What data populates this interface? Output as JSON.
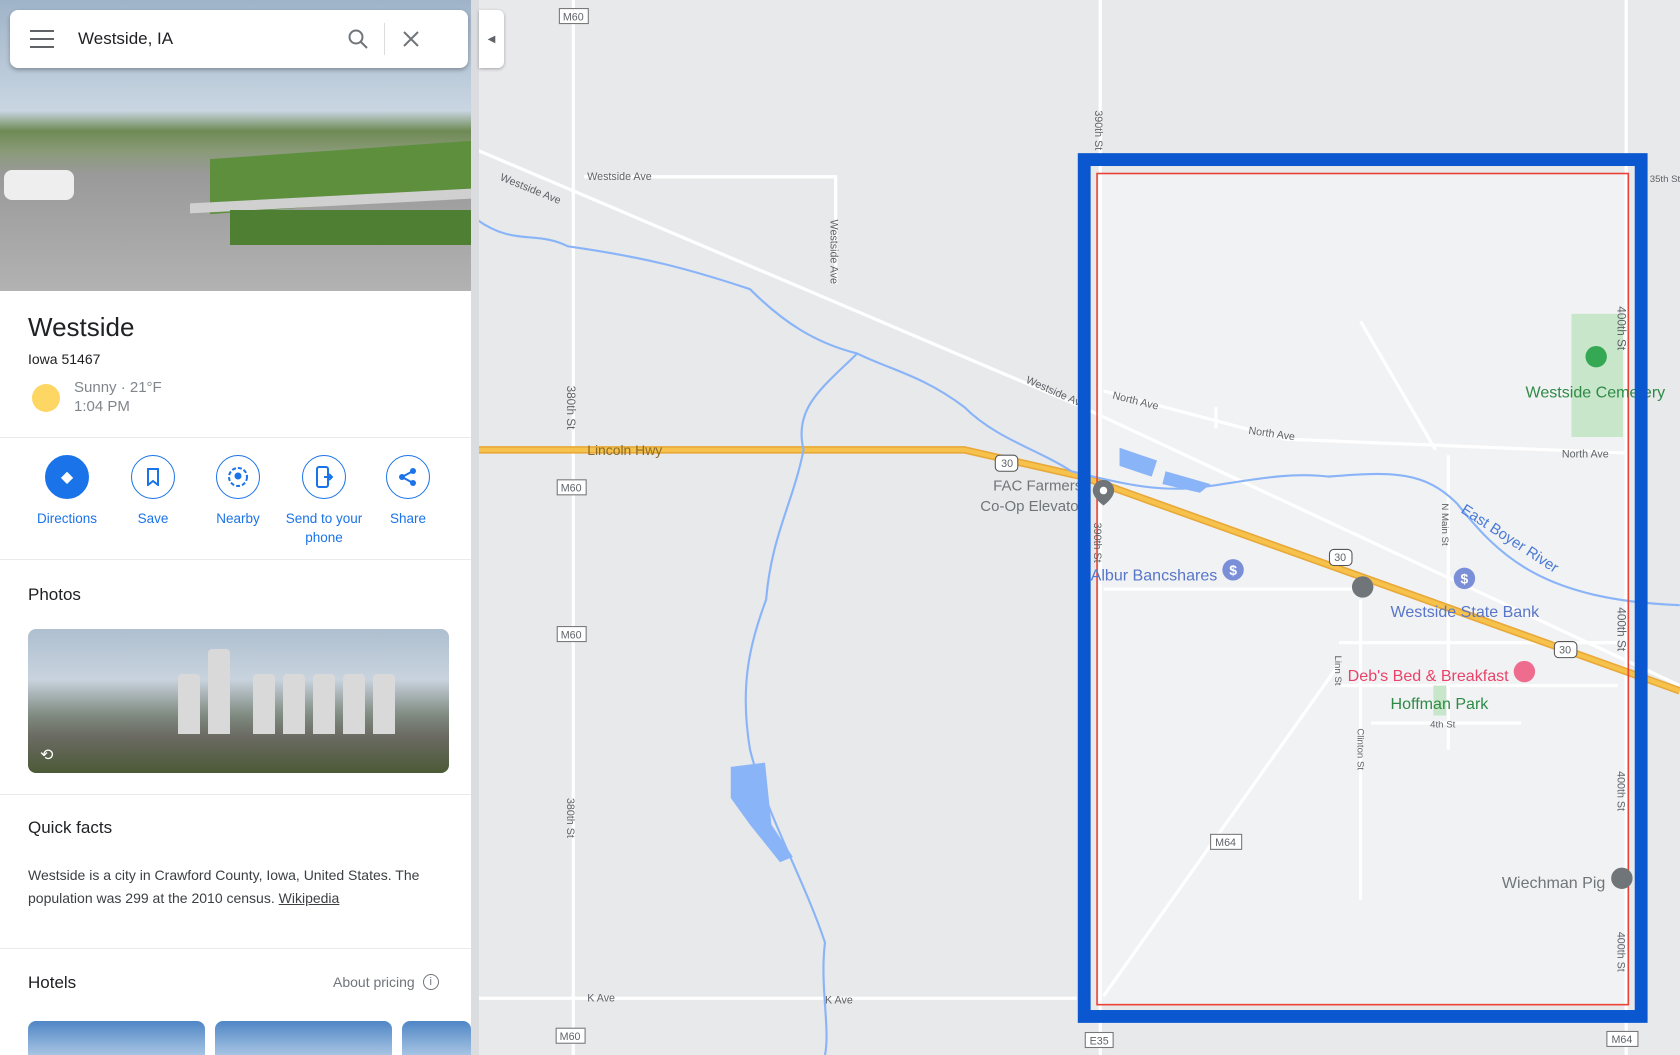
{
  "search": {
    "value": "Westside, IA",
    "menu_icon": "menu-icon",
    "search_icon": "search-icon",
    "close_icon": "close-icon"
  },
  "place": {
    "title": "Westside",
    "address": "Iowa 51467",
    "weather": "Sunny · 21°F",
    "time": "1:04 PM"
  },
  "actions": [
    {
      "label": "Directions",
      "icon": "directions-icon"
    },
    {
      "label": "Save",
      "icon": "bookmark-icon"
    },
    {
      "label": "Nearby",
      "icon": "nearby-icon"
    },
    {
      "label": "Send to your phone",
      "icon": "phone-send-icon"
    },
    {
      "label": "Share",
      "icon": "share-icon"
    }
  ],
  "photos": {
    "heading": "Photos"
  },
  "quick_facts": {
    "heading": "Quick facts",
    "text": "Westside is a city in Crawford County, Iowa, United States. The population was 299 at the 2010 census.",
    "link": "Wikipedia"
  },
  "hotels": {
    "heading": "Hotels",
    "pricing": "About pricing"
  },
  "map": {
    "shields": {
      "m60": "M60",
      "us30": "30",
      "m64": "M64",
      "e35": "E35"
    },
    "roads": {
      "westside_ave": "Westside Ave",
      "st380": "380th St",
      "st390": "390th St",
      "st400": "400th St",
      "lincoln": "Lincoln Hwy",
      "north_ave": "North Ave",
      "k_ave": "K Ave",
      "n_main": "N Main St",
      "linn": "Linn St",
      "clinton": "Clinton St",
      "fourth": "4th St",
      "st35": "35th St"
    },
    "places": {
      "fac1": "FAC Farmers",
      "fac2": "Co-Op Elevator",
      "albur": "Albur Bancshares",
      "bank": "Westside State Bank",
      "debs": "Deb's Bed & Breakfast",
      "park": "Hoffman Park",
      "cemetery": "Westside Cemetery",
      "river": "East Boyer River",
      "wiechman": "Wiechman Pig"
    },
    "colors": {
      "highlight": "#0b57d0",
      "boundary": "#ea4335",
      "highway": "#f6c24b",
      "water": "#8ab4f8"
    }
  }
}
